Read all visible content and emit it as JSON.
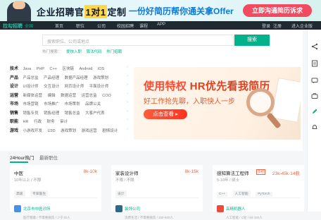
{
  "banner": {
    "title_part1": "企业招聘官",
    "title_highlight": "1对1",
    "title_part2": "定制",
    "subtitle": "一份好简历帮你通关拿Offer",
    "cta_label": "立即沟通简历诉求"
  },
  "nav": {
    "logo": "拉勾招聘",
    "city": "全国",
    "items": [
      "首页",
      "职位",
      "公司",
      "校园招聘",
      "课程",
      "APP"
    ],
    "right": [
      "登录",
      "注册",
      "进入企业版"
    ]
  },
  "search": {
    "placeholder": "搜索职位、公司或地点",
    "button_label": "搜索",
    "hot_label": "热门搜索：",
    "hot_keywords": [
      "爱快入职",
      "算法代码",
      "热门招聘"
    ]
  },
  "categories": [
    {
      "name": "技术",
      "subs": [
        "Java",
        "PHP",
        "C++",
        "区块链",
        "Android",
        "iOS"
      ]
    },
    {
      "name": "产品",
      "subs": [
        "产品总监",
        "产品经理",
        "数据产品经理",
        "游戏策划"
      ]
    },
    {
      "name": "设计",
      "subs": [
        "UI设计师",
        "交互设计",
        "网页设计师",
        "平面设计师"
      ]
    },
    {
      "name": "运营",
      "subs": [
        "新媒体运营",
        "编辑",
        "数据运营",
        "运营总监",
        "COO"
      ]
    },
    {
      "name": "市场",
      "subs": [
        "市场营销",
        "市场推广",
        "市场策划",
        "品牌公关"
      ]
    },
    {
      "name": "销售",
      "subs": [
        "销售专员",
        "销售经理",
        "销售总监",
        "大客户代表"
      ]
    },
    {
      "name": "职能",
      "subs": [
        "HR",
        "行政",
        "财务",
        "审计"
      ]
    },
    {
      "name": "游戏",
      "subs": [
        "小游戏开发",
        "U3D",
        "游戏策划",
        "游戏运营",
        "剧情设计"
      ]
    }
  ],
  "ad": {
    "headline_red": "使用特权",
    "headline_dark": "HR优先看我简历",
    "subline": "好工作抢先聊，入职快人一步",
    "button_label": "点击查看"
  },
  "tabs": {
    "items": [
      "24Hour热门",
      "最新职位"
    ],
    "active_index": 0
  },
  "jobs": [
    {
      "title": "中医",
      "salary": "8k-10k",
      "meta": "10年以上 / 不限",
      "tags": [
        "高级",
        "专家医生"
      ],
      "company": "北京市中医诊所",
      "company_info": "医疗健康 / 不需要融资 / 少于15人"
    },
    {
      "title": "家装设计师",
      "salary": "8k-15k",
      "meta": "不限 / 不限",
      "tags": [
        "设计"
      ],
      "company": "装饰公司",
      "company_info": "消费生活 / 不需要融资 / 150-500人"
    },
    {
      "title": "感知算法工程师",
      "urgent": "急招",
      "salary": "23k-45k·14薪",
      "meta": "5-10年 / 硕士",
      "tags": [
        "C++",
        "人工智能",
        "PyTorch"
      ],
      "company": "高精机器人",
      "company_info": "人工智能 / C轮 / 50-150人"
    }
  ],
  "sidebar_icons": [
    "share-icon",
    "resume-icon",
    "message-icon",
    "briefcase-icon",
    "edit-icon",
    "bell-icon"
  ],
  "colors": {
    "brand": "#00b38a",
    "salary": "#f5633f",
    "cta_red": "#f24b61"
  }
}
